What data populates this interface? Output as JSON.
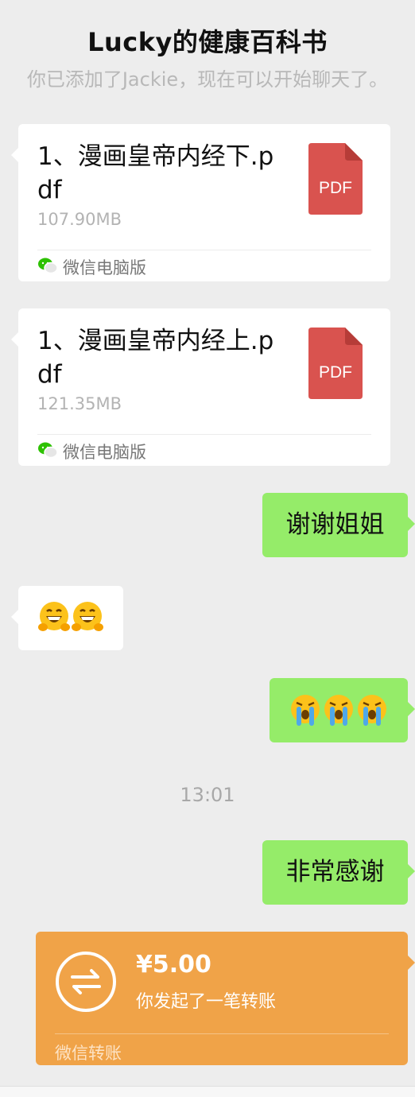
{
  "header": {
    "title": "Lucky的健康百科书"
  },
  "system_message": "你已添加了Jackie，现在可以开始聊天了。",
  "files": [
    {
      "name": "1、漫画皇帝内经下.pdf",
      "size": "107.90MB",
      "icon": "PDF",
      "source": "微信电脑版"
    },
    {
      "name": "1、漫画皇帝内经上.pdf",
      "size": "121.35MB",
      "icon": "PDF",
      "source": "微信电脑版"
    }
  ],
  "messages": {
    "thanks_sister": "谢谢姐姐",
    "grin_emojis": "grinning-face-emoji ×2",
    "cry_emojis": "crying-face-emoji ×3",
    "very_thanks": "非常感谢"
  },
  "timestamp": "13:01",
  "transfer": {
    "amount": "¥5.00",
    "description": "你发起了一笔转账",
    "source": "微信转账"
  },
  "colors": {
    "background": "#ededed",
    "sent_bubble": "#95ec69",
    "received_bubble": "#ffffff",
    "pdf_icon": "#d9534f",
    "transfer_card": "#f0a348"
  }
}
